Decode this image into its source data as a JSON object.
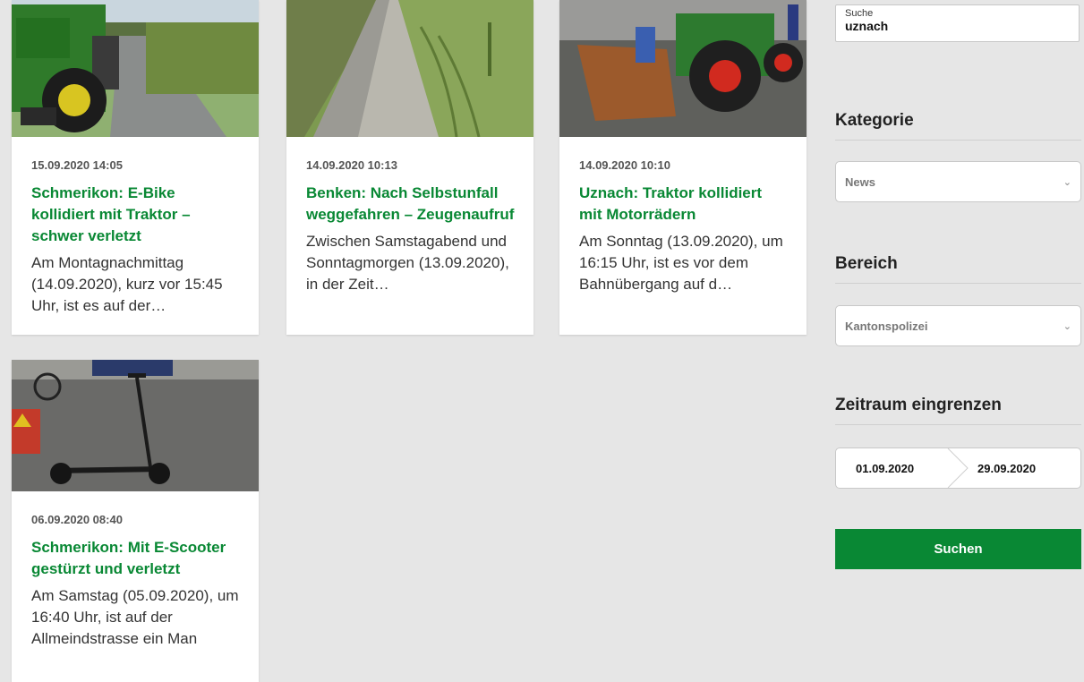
{
  "articles": [
    {
      "date": "15.09.2020 14:05",
      "title": "Schmerikon: E-Bike kollidiert mit Traktor – schwer verletzt",
      "excerpt": "Am Montagnachmittag (14.09.2020), kurz vor 15:45 Uhr, ist es auf der…"
    },
    {
      "date": "14.09.2020 10:13",
      "title": "Benken: Nach Selbstunfall weggefahren – Zeugenaufruf",
      "excerpt": "Zwischen Samstagabend und Sonntagmorgen (13.09.2020), in der Zeit…"
    },
    {
      "date": "14.09.2020 10:10",
      "title": "Uznach: Traktor kollidiert mit Motorrädern",
      "excerpt": "Am Sonntag (13.09.2020), um 16:15 Uhr, ist es vor dem Bahnübergang auf d…"
    },
    {
      "date": "06.09.2020 08:40",
      "title": "Schmerikon: Mit E-Scooter gestürzt und verletzt",
      "excerpt": "Am Samstag (05.09.2020), um 16:40 Uhr, ist auf der Allmeindstrasse ein Man"
    }
  ],
  "sidebar": {
    "search_label": "Suche",
    "search_value": "uznach",
    "category_heading": "Kategorie",
    "category_selected": "News",
    "area_heading": "Bereich",
    "area_selected": "Kantonspolizei",
    "period_heading": "Zeitraum eingrenzen",
    "date_from": "01.09.2020",
    "date_to": "29.09.2020",
    "search_button": "Suchen"
  },
  "colors": {
    "accent": "#098834",
    "background": "#e6e6e6"
  }
}
